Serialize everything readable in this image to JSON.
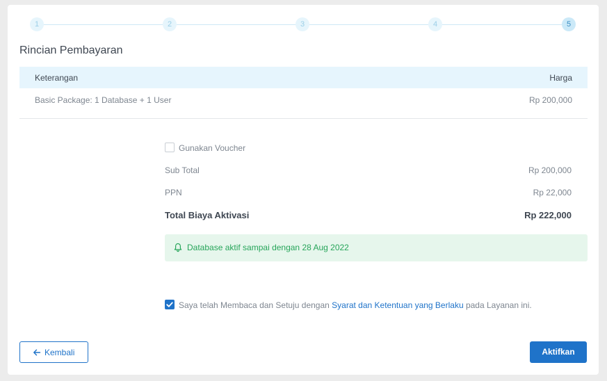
{
  "stepper": {
    "steps": [
      {
        "label": "1",
        "active": false
      },
      {
        "label": "2",
        "active": false
      },
      {
        "label": "3",
        "active": false
      },
      {
        "label": "4",
        "active": false
      },
      {
        "label": "5",
        "active": true
      }
    ]
  },
  "section_title": "Rincian Pembayaran",
  "table": {
    "headers": [
      "Keterangan",
      "Harga"
    ],
    "rows": [
      {
        "description": "Basic Package: 1 Database + 1 User",
        "price": "Rp 200,000"
      }
    ]
  },
  "voucher": {
    "label": "Gunakan Voucher",
    "checked": false
  },
  "summary": {
    "subtotal_label": "Sub Total",
    "subtotal_value": "Rp 200,000",
    "tax_label": "PPN",
    "tax_value": "Rp 22,000",
    "total_label": "Total Biaya Aktivasi",
    "total_value": "Rp 222,000"
  },
  "notice": {
    "icon": "bell-icon",
    "text": "Database aktif sampai dengan 28 Aug 2022"
  },
  "agreement": {
    "checked": true,
    "text_before": "Saya telah Membaca dan Setuju dengan ",
    "link_text": "Syarat dan Ketentuan yang Berlaku",
    "text_after": " pada Layanan ini."
  },
  "buttons": {
    "back_label": "Kembali",
    "activate_label": "Aktifkan"
  },
  "colors": {
    "primary": "#1f73c9",
    "success_text": "#27a55a",
    "success_bg": "#e6f6ec",
    "table_header_bg": "#e6f5fd"
  }
}
